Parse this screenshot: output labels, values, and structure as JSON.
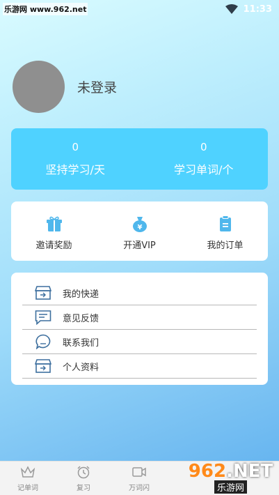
{
  "status_bar": {
    "watermark": "乐游网 www.962.net",
    "time": "11:33"
  },
  "profile": {
    "login_status": "未登录"
  },
  "stats": [
    {
      "value": "0",
      "label": "坚持学习/天"
    },
    {
      "value": "0",
      "label": "学习单词/个"
    }
  ],
  "actions": [
    {
      "label": "邀请奖励",
      "icon": "gift-icon"
    },
    {
      "label": "开通VIP",
      "icon": "money-bag-icon"
    },
    {
      "label": "我的订单",
      "icon": "clipboard-icon"
    }
  ],
  "menu": [
    {
      "label": "我的快递",
      "icon": "delivery-box-icon"
    },
    {
      "label": "意见反馈",
      "icon": "feedback-icon"
    },
    {
      "label": "联系我们",
      "icon": "chat-bubble-icon"
    },
    {
      "label": "个人资料",
      "icon": "profile-box-icon"
    }
  ],
  "bottom_nav": [
    {
      "label": "记单词",
      "icon": "crown-icon"
    },
    {
      "label": "复习",
      "icon": "alarm-clock-icon"
    },
    {
      "label": "万词闪",
      "icon": "video-icon"
    }
  ],
  "logo_overlay": {
    "main_number": "962",
    "main_suffix": ".NET",
    "sub": "乐游网"
  },
  "colors": {
    "stats_card": "#4fd2ff",
    "icon_blue": "#4fb7ec",
    "menu_icon": "#3d6f9e",
    "avatar": "#8f8f8f"
  }
}
